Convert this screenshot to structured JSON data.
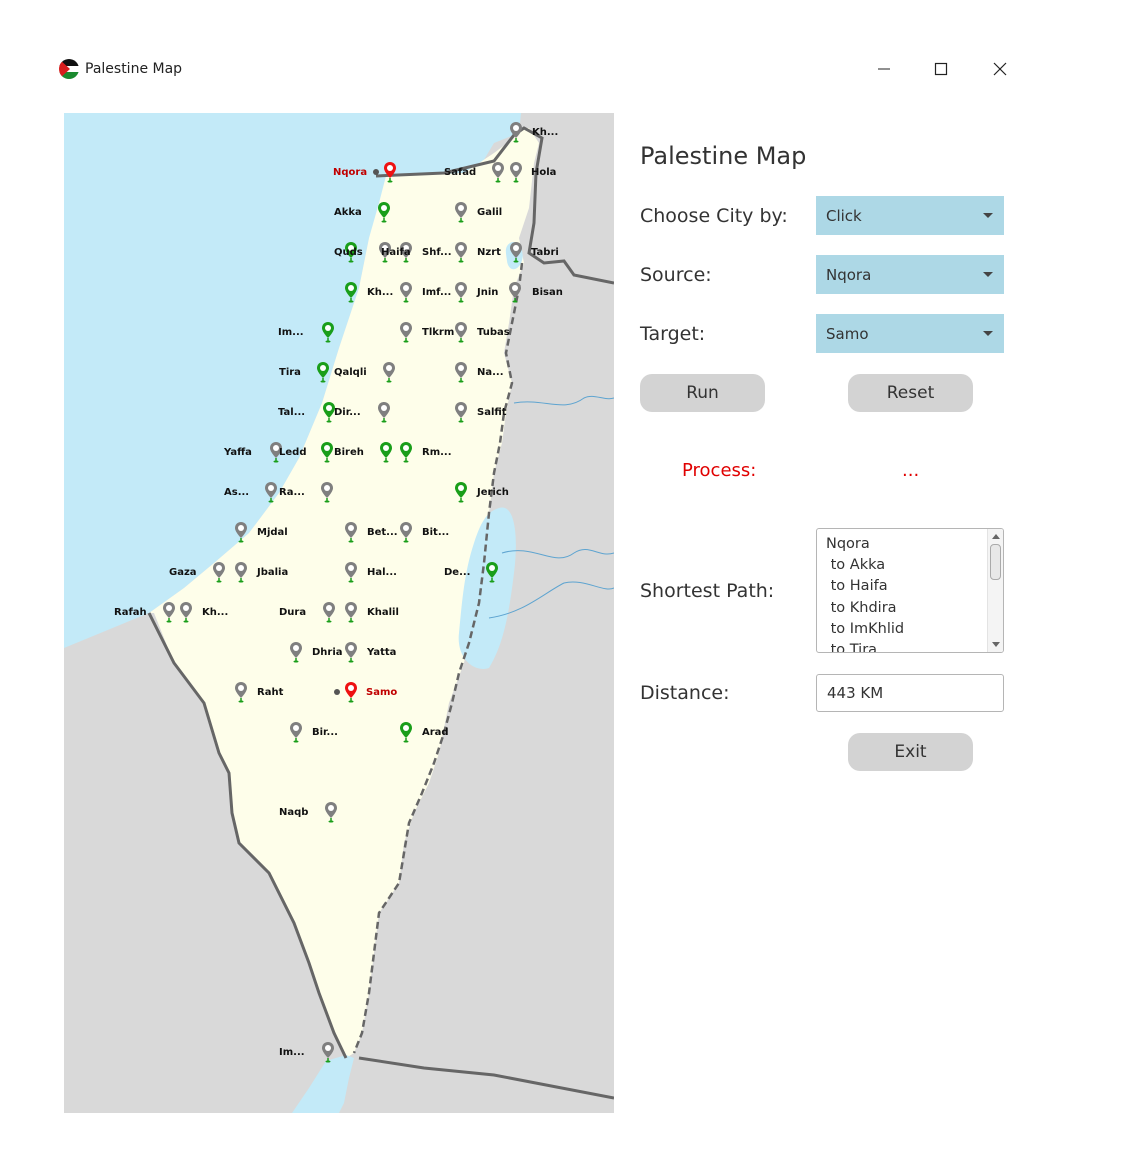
{
  "window": {
    "title": "Palestine Map",
    "controls": [
      "minimize",
      "maximize",
      "close"
    ]
  },
  "map": {
    "colors": {
      "land": "#fefeea",
      "water": "#c3eaf8",
      "neighbor": "#dcdcdc",
      "pin_gray": "#7f7f7f",
      "pin_green": "#1a9e1a",
      "pin_red": "#ee1111"
    },
    "source_label": "Nqora",
    "target_label": "Samo",
    "city_labels": [
      "Kh...",
      "Safad",
      "Hola",
      "Akka",
      "Galil",
      "Quds",
      "Haifa",
      "Shf...",
      "Nzrt",
      "Tabri",
      "Kh...",
      "Imf...",
      "Jnin",
      "Bisan",
      "Im...",
      "Tlkrm",
      "Tubas",
      "Tira",
      "Qalqli",
      "Na...",
      "Tal...",
      "Dir...",
      "Salfit",
      "Yaffa",
      "Ledd",
      "Bireh",
      "Rm...",
      "As...",
      "Ra...",
      "Jerich",
      "Mjdal",
      "Bet...",
      "Bit...",
      "Gaza",
      "Jbalia",
      "Hal...",
      "De...",
      "Rafah",
      "Kh...",
      "Dura",
      "Khalil",
      "Dhria",
      "Yatta",
      "Raht",
      "Bir...",
      "Arad",
      "Naqb",
      "Im..."
    ]
  },
  "panel": {
    "title": "Palestine Map",
    "choose_label": "Choose City by:",
    "choose_value": "Click",
    "source_label": "Source:",
    "source_value": "Nqora",
    "target_label": "Target:",
    "target_value": "Samo",
    "run_label": "Run",
    "reset_label": "Reset",
    "process_label": "Process:",
    "process_value": "...",
    "path_label": "Shortest Path:",
    "path_items": [
      "Nqora",
      " to Akka",
      " to Haifa",
      " to Khdira",
      " to ImKhlid",
      " to Tira"
    ],
    "distance_label": "Distance:",
    "distance_value": "443 KM",
    "exit_label": "Exit"
  }
}
